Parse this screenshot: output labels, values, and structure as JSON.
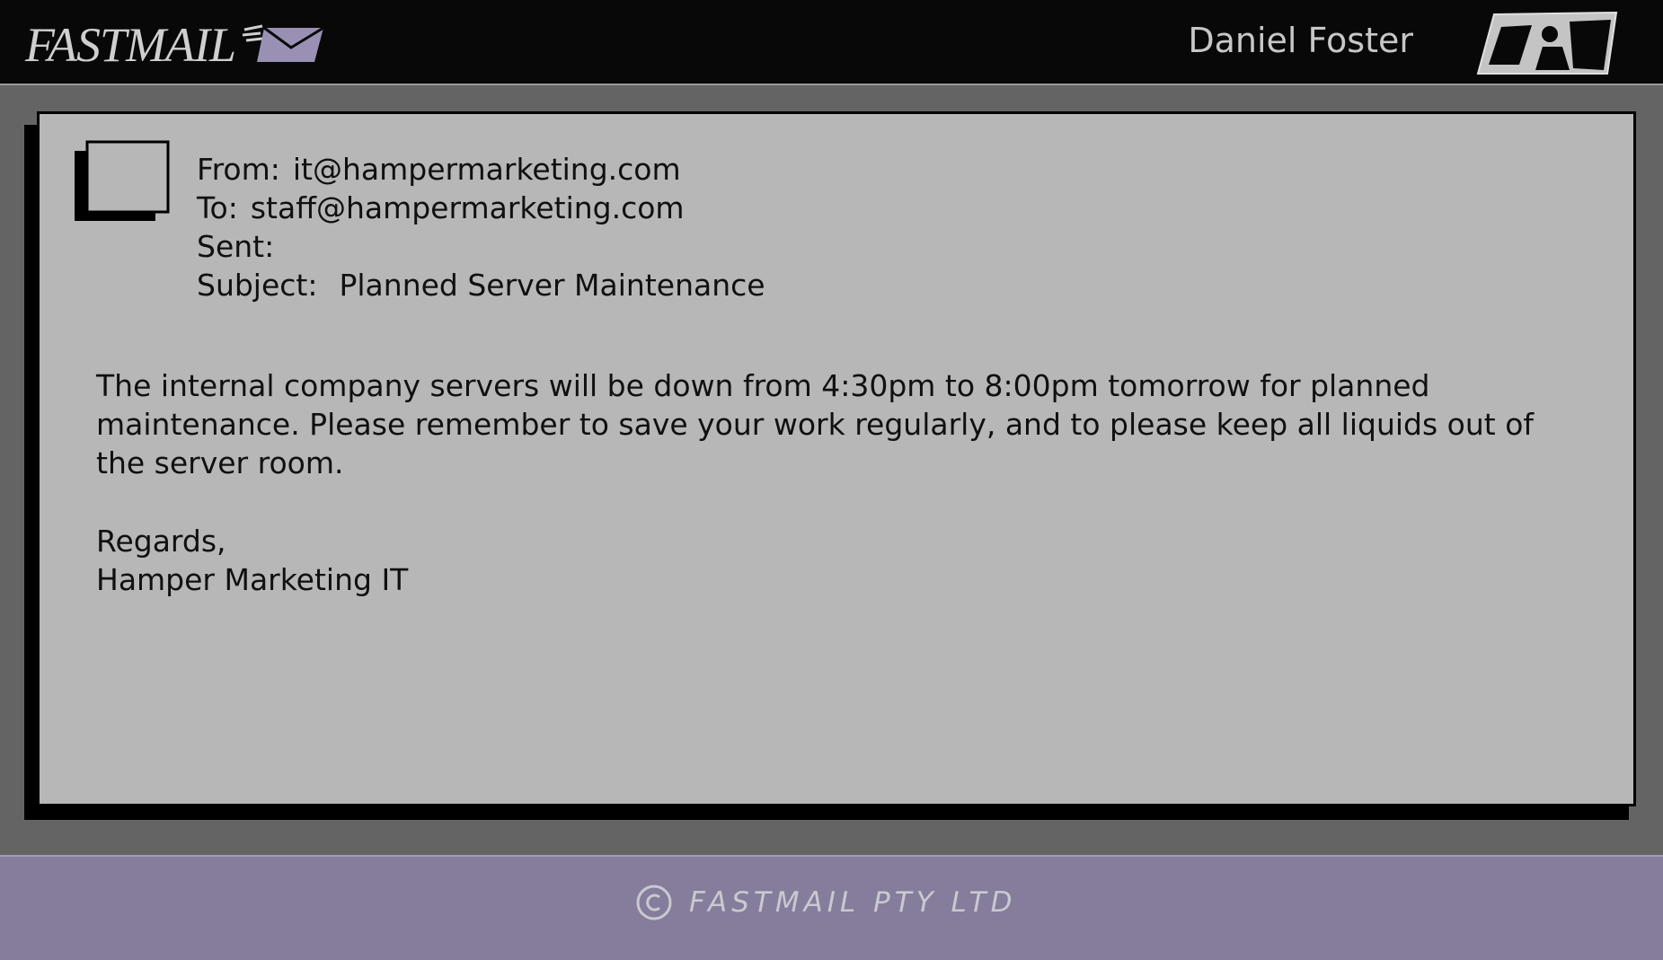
{
  "app": {
    "logo_text": "FASTMAIL",
    "accent_color": "#867c9c"
  },
  "header": {
    "user_name": "Daniel Foster",
    "profile_icon": "profile-card-icon"
  },
  "email": {
    "from_label": "From:",
    "from_value": "it@hampermarketing.com",
    "to_label": "To:",
    "to_value": "staff@hampermarketing.com",
    "sent_label": "Sent:",
    "sent_value": "",
    "subject_label": "Subject:",
    "subject_value": "Planned Server Maintenance",
    "body": "The internal company servers will be down from 4:30pm to 8:00pm tomorrow for planned maintenance. Please remember to save your work regularly, and to please keep all liquids out of the server room.",
    "signoff_line1": "Regards,",
    "signoff_line2": "Hamper Marketing IT"
  },
  "footer": {
    "copyright_text": "FASTMAIL PTY LTD"
  }
}
